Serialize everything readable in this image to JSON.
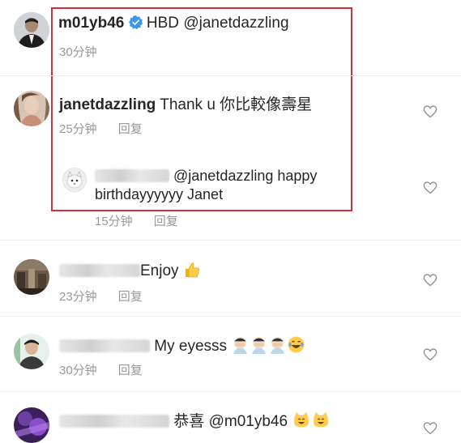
{
  "comments": [
    {
      "user": "m01yb46",
      "verified": true,
      "text": "HBD",
      "mention": "@janetdazzling",
      "time": "30分钟"
    },
    {
      "user": "janetdazzling",
      "text": "Thank u 你比較像壽星",
      "time": "25分钟",
      "reply_label": "回复"
    },
    {
      "mention": "@janetdazzling",
      "text_line1": "happy",
      "text_line2": "birthdayyyyyy Janet",
      "time": "15分钟",
      "reply_label": "回复"
    },
    {
      "text": "Enjoy",
      "time": "23分钟",
      "reply_label": "回复"
    },
    {
      "text": "My eyesss",
      "time": "30分钟",
      "reply_label": "回复"
    },
    {
      "text": "恭喜",
      "mention": "@m01yb46"
    }
  ],
  "colors": {
    "highlight_box": "#d0313a",
    "verified_badge": "#3897f0",
    "meta_text": "#999999"
  },
  "icons": [
    "verified-badge-icon",
    "heart-icon",
    "thumbs-up-emoji",
    "facepalm-emoji",
    "laughing-emoji",
    "cat-emoji"
  ]
}
